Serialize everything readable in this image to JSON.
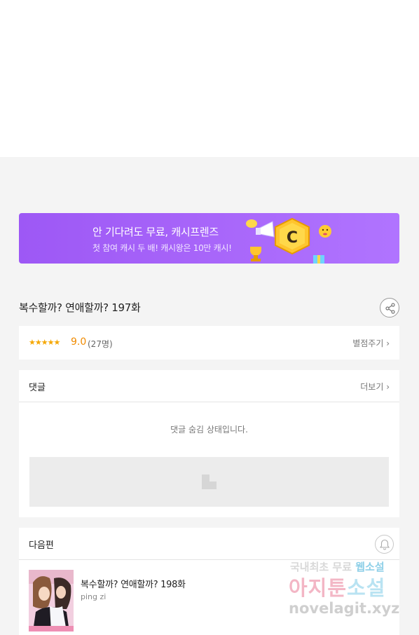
{
  "banner": {
    "title": "안 기다려도 무료, 캐시프렌즈",
    "subtitle": "첫 참여 캐시 두 배! 캐시왕은 10만 캐시!",
    "badge_letter": "C"
  },
  "episode": {
    "title": "복수할까? 연애할까? 197화"
  },
  "rating": {
    "stars": "★★★★★",
    "score": "9.0",
    "count": "(27명)",
    "rate_label": "별점주기 ›",
    "value": 9.0,
    "max": 10
  },
  "comments": {
    "label": "댓글",
    "more_label": "더보기 ›",
    "hidden_message": "댓글 숨김 상태입니다."
  },
  "next": {
    "label": "다음편",
    "title": "복수할까? 연애할까? 198화",
    "author": "ping zi"
  },
  "watermark": {
    "line1_a": "국내최초 무료 ",
    "line1_b": "웹소설",
    "line2_a": "아지툰",
    "line2_b": "소설",
    "line3": "novelagit.xyz"
  },
  "colors": {
    "banner_gradient": [
      "#9d58f5",
      "#b074ff"
    ],
    "score": "#f08a00",
    "stars": "#f5a700",
    "page_bg": "#f4f4f4"
  },
  "icons": {
    "share": "share-icon",
    "bell": "bell-icon",
    "chevron": "chevron-right-icon"
  }
}
